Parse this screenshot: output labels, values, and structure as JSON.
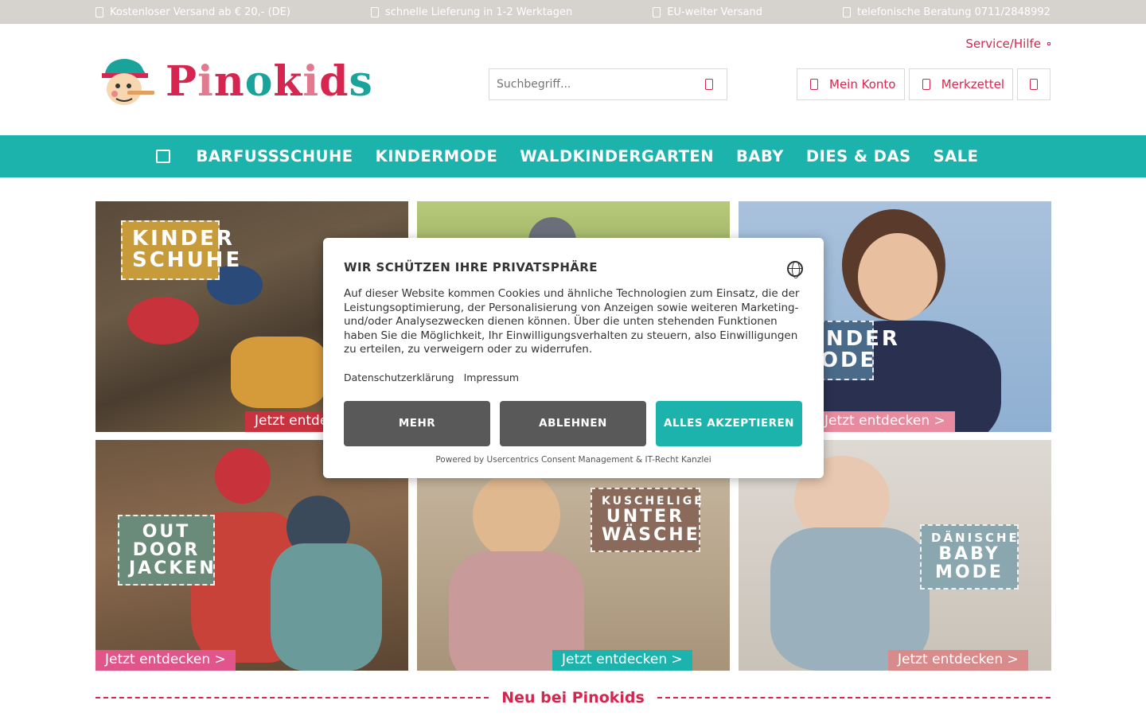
{
  "topbar": {
    "usps": [
      "Kostenloser Versand ab € 20,- (DE)",
      "schnelle Lieferung in 1-2 Werktagen",
      "EU-weiter Versand",
      "telefonische Beratung 0711/2848992"
    ]
  },
  "header": {
    "service_label": "Service/Hilfe",
    "logo_text": "Pinokids",
    "search_placeholder": "Suchbegriff...",
    "account_label": "Mein Konto",
    "wishlist_label": "Merkzettel"
  },
  "nav": {
    "items": [
      "BARFUSSSCHUHE",
      "KINDERMODE",
      "WALDKINDERGARTEN",
      "BABY",
      "DIES & DAS",
      "SALE"
    ]
  },
  "tiles": [
    {
      "label_line1": "KINDER",
      "label_line2": "SCHUHE",
      "label_line3": "",
      "cta": "Jetzt entdecken >",
      "cta_color": "#c9323f"
    },
    {
      "label_line1": "",
      "label_line2": "",
      "label_line3": "",
      "cta": "",
      "cta_color": "#1db3ad"
    },
    {
      "label_line1": "KINDER",
      "label_line2": "MODE",
      "label_line3": "",
      "cta": "Jetzt entdecken >",
      "cta_color": "#e88aa0"
    },
    {
      "label_line1": "OUT",
      "label_line2": "DOOR",
      "label_line3": "JACKEN",
      "cta": "Jetzt entdecken >",
      "cta_color": "#e0568a"
    },
    {
      "label_line1": "KUSCHELIGE",
      "label_line2": "UNTER",
      "label_line3": "WÄSCHE",
      "cta": "Jetzt entdecken >",
      "cta_color": "#1db3ad"
    },
    {
      "label_line1": "DÄNISCHE",
      "label_line2": "BABY",
      "label_line3": "MODE",
      "cta": "Jetzt entdecken >",
      "cta_color": "#d98a8a"
    }
  ],
  "section": {
    "title": "Neu bei Pinokids"
  },
  "consent": {
    "title": "WIR SCHÜTZEN IHRE PRIVATSPHÄRE",
    "text": "Auf dieser Website kommen Cookies und ähnliche Technologien zum Einsatz, die der Leistungsoptimierung, der Personalisierung von Anzeigen sowie weiteren Marketing- und/oder Analysezwecken dienen können. Über die unten stehenden Funktionen haben Sie die Möglichkeit, Ihr Einwilligungsverhalten zu steuern, also Einwilligungen zu erteilen, zu verweigern oder zu widerrufen.",
    "link_privacy": "Datenschutzerklärung",
    "link_imprint": "Impressum",
    "btn_more": "MEHR",
    "btn_decline": "ABLEHNEN",
    "btn_accept": "ALLES AKZEPTIEREN",
    "powered": "Powered by Usercentrics Consent Management & IT-Recht Kanzlei"
  },
  "colors": {
    "brand_pink": "#d6264f",
    "brand_teal": "#1db3ad",
    "button_grey": "#595959"
  }
}
